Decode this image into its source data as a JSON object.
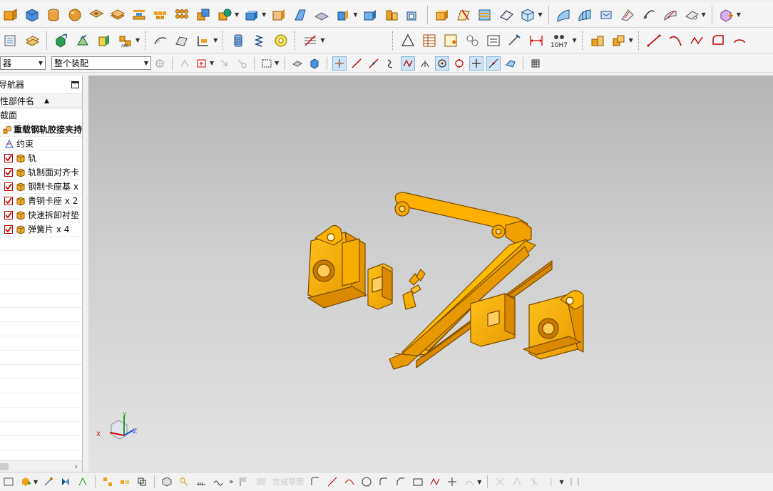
{
  "toolbar": {
    "row2_badge": "10H7",
    "filter_left_value": "器",
    "assembly_scope_value": "整个装配"
  },
  "navigator": {
    "title": "导航器",
    "column_header": "性部件名",
    "items": [
      {
        "label": "截面",
        "type": "section"
      },
      {
        "label": "重载钢轨胶接夹持",
        "type": "assembly",
        "bold": true
      },
      {
        "label": "约束",
        "type": "constraint"
      },
      {
        "label": "轨",
        "type": "part",
        "checked": true
      },
      {
        "label": "轨制面对齐卡",
        "type": "part",
        "checked": true
      },
      {
        "label": "钢制卡座基 x",
        "type": "part",
        "checked": true
      },
      {
        "label": "青铜卡座 x 2",
        "type": "part",
        "checked": true
      },
      {
        "label": "快速拆卸衬垫",
        "type": "part",
        "checked": true
      },
      {
        "label": "弹簧片 x 4",
        "type": "part",
        "checked": true
      }
    ]
  },
  "triad": {
    "x": "X",
    "y": "Y",
    "z": "Z"
  },
  "bottom_bar": {
    "sketch_finish": "完成草图"
  },
  "colors": {
    "part_orange": "#f2a500",
    "part_dark": "#c27e00",
    "accent_blue": "#2c6fb7"
  }
}
